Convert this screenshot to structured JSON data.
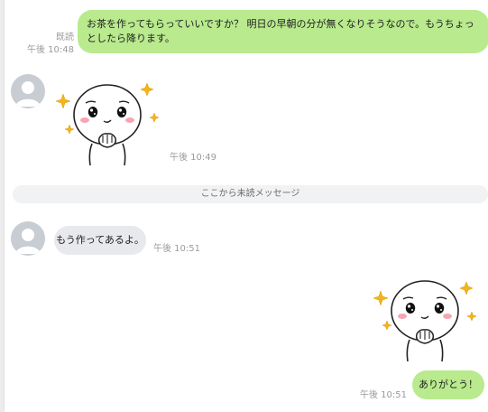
{
  "messages": [
    {
      "side": "right",
      "read_label": "既読",
      "time": "午後 10:48",
      "text": "お茶を作ってもらっていいですか？ 明日の早朝の分が無くなりそうなので。もうちょっとしたら降ります。"
    },
    {
      "side": "left",
      "type": "sticker",
      "sticker_icon": "sticker-pleading-face-icon",
      "time": "午後 10:49"
    },
    {
      "side": "left",
      "text": "もう作ってあるよ。",
      "time": "午後 10:51"
    },
    {
      "side": "right",
      "type": "sticker",
      "sticker_icon": "sticker-pleading-face-icon"
    },
    {
      "side": "right",
      "text": "ありがとう！",
      "time": "午後 10:51"
    }
  ],
  "divider": {
    "label": "ここから未読メッセージ"
  },
  "colors": {
    "bubble_sent": "#b9ea8e",
    "bubble_received": "#e7e9ed",
    "meta_text": "#9b9b9b",
    "divider_bg": "#f1f2f3",
    "sparkle": "#f2b51c",
    "cheek": "#f6a5b4"
  }
}
